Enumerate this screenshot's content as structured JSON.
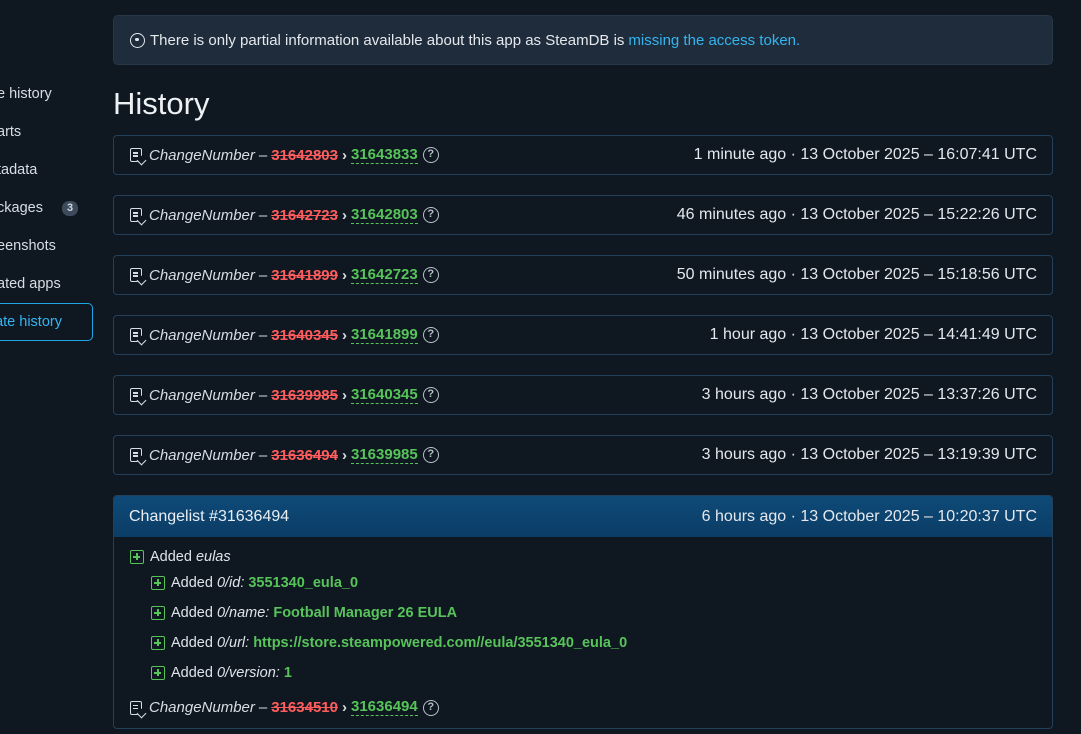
{
  "sidebar": {
    "items": [
      {
        "label": "e history"
      },
      {
        "label": "arts"
      },
      {
        "label": "tadata"
      },
      {
        "label": "ckages",
        "badge": "3"
      },
      {
        "label": "eenshots"
      },
      {
        "label": "ated apps"
      },
      {
        "label": "date history",
        "active": true
      }
    ]
  },
  "notice": {
    "text": "There is only partial information available about this app as SteamDB is",
    "link": "missing the access token."
  },
  "history": {
    "title": "History",
    "rows": [
      {
        "label": "ChangeNumber",
        "old": "31642803",
        "new": "31643833",
        "time": "1 minute ago · 13 October 2025 – 16:07:41 UTC"
      },
      {
        "label": "ChangeNumber",
        "old": "31642723",
        "new": "31642803",
        "time": "46 minutes ago · 13 October 2025 – 15:22:26 UTC"
      },
      {
        "label": "ChangeNumber",
        "old": "31641899",
        "new": "31642723",
        "time": "50 minutes ago · 13 October 2025 – 15:18:56 UTC"
      },
      {
        "label": "ChangeNumber",
        "old": "31640345",
        "new": "31641899",
        "time": "1 hour ago · 13 October 2025 – 14:41:49 UTC"
      },
      {
        "label": "ChangeNumber",
        "old": "31639985",
        "new": "31640345",
        "time": "3 hours ago · 13 October 2025 – 13:37:26 UTC"
      },
      {
        "label": "ChangeNumber",
        "old": "31636494",
        "new": "31639985",
        "time": "3 hours ago · 13 October 2025 – 13:19:39 UTC"
      }
    ]
  },
  "changelist": {
    "title": "Changelist #31636494",
    "time": "6 hours ago · 13 October 2025 – 10:20:37 UTC",
    "added_word": "Added",
    "root_key": "eulas",
    "entries": [
      {
        "key": "0/id:",
        "value": "3551340_eula_0"
      },
      {
        "key": "0/name:",
        "value": "Football Manager 26 EULA"
      },
      {
        "key": "0/url:",
        "value": "https://store.steampowered.com//eula/3551340_eula_0"
      },
      {
        "key": "0/version:",
        "value": "1"
      }
    ],
    "change": {
      "label": "ChangeNumber",
      "old": "31634510",
      "new": "31636494"
    }
  },
  "icons": {
    "question": "?"
  },
  "colors": {
    "accent": "#33b5f0",
    "added": "#57c45a",
    "removed": "#ff5d5d",
    "header": "#0e4a78"
  }
}
